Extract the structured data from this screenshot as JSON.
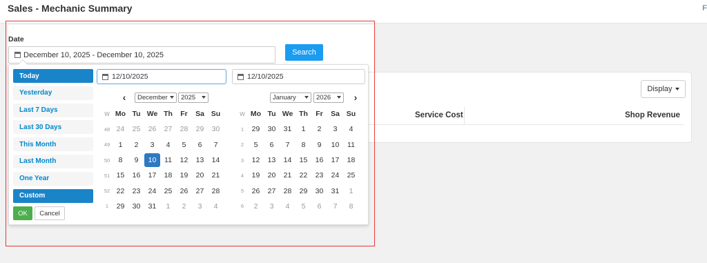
{
  "page": {
    "title": "Sales - Mechanic Summary",
    "top_link": "F"
  },
  "form": {
    "date_label": "Date",
    "date_range_value": "December 10, 2025 - December 10, 2025",
    "search_label": "Search"
  },
  "ranges": {
    "items": [
      "Today",
      "Yesterday",
      "Last 7 Days",
      "Last 30 Days",
      "This Month",
      "Last Month",
      "One Year",
      "Custom"
    ],
    "ok_label": "OK",
    "cancel_label": "Cancel"
  },
  "calendar": {
    "start_input": "12/10/2025",
    "end_input": "12/10/2025",
    "weekday_headers": [
      "W",
      "Mo",
      "Tu",
      "We",
      "Th",
      "Fr",
      "Sa",
      "Su"
    ],
    "left": {
      "month": "December",
      "year": "2025",
      "weeks": [
        [
          "48",
          "24",
          "25",
          "26",
          "27",
          "28",
          "29",
          "30"
        ],
        [
          "49",
          "1",
          "2",
          "3",
          "4",
          "5",
          "6",
          "7"
        ],
        [
          "50",
          "8",
          "9",
          "10",
          "11",
          "12",
          "13",
          "14"
        ],
        [
          "51",
          "15",
          "16",
          "17",
          "18",
          "19",
          "20",
          "21"
        ],
        [
          "52",
          "22",
          "23",
          "24",
          "25",
          "26",
          "27",
          "28"
        ],
        [
          "1",
          "29",
          "30",
          "31",
          "1",
          "2",
          "3",
          "4"
        ]
      ]
    },
    "right": {
      "month": "January",
      "year": "2026",
      "weeks": [
        [
          "1",
          "29",
          "30",
          "31",
          "1",
          "2",
          "3",
          "4"
        ],
        [
          "2",
          "5",
          "6",
          "7",
          "8",
          "9",
          "10",
          "11"
        ],
        [
          "3",
          "12",
          "13",
          "14",
          "15",
          "16",
          "17",
          "18"
        ],
        [
          "4",
          "19",
          "20",
          "21",
          "22",
          "23",
          "24",
          "25"
        ],
        [
          "5",
          "26",
          "27",
          "28",
          "29",
          "30",
          "31",
          "1"
        ],
        [
          "6",
          "2",
          "3",
          "4",
          "5",
          "6",
          "7",
          "8"
        ]
      ]
    }
  },
  "report": {
    "display_label": "Display",
    "columns": [
      "Service Cost",
      "Shop Revenue"
    ]
  },
  "colors": {
    "primary": "#1a9cf0",
    "selected_day": "#2f79c2",
    "ok_green": "#4cae4c",
    "range_link": "#0088cc",
    "highlight_outline": "#e53935"
  }
}
